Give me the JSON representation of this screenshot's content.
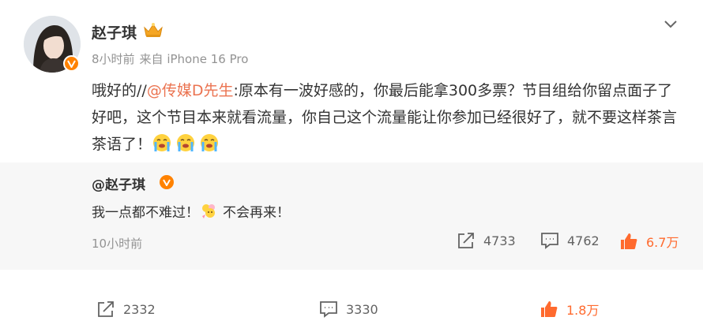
{
  "post": {
    "author": "赵子琪",
    "time": "8小时前",
    "source": "来自 iPhone 16 Pro",
    "text_prefix": "哦好的//",
    "mention": "@传媒D先生",
    "text_body": ":原本有一波好感的，你最后能拿300多票？节目组给你留点面子了好吧，这个节目本来就看流量，你自己这个流量能让你参加已经很好了，就不要这样茶言茶语了！",
    "emoji_count_label": "3"
  },
  "repost": {
    "author": "@赵子琪",
    "text_before": "我一点都不难过！",
    "text_after": "不会再来！",
    "time": "10小时前",
    "repost_count": "4733",
    "comment_count": "4762",
    "like_count": "6.7万"
  },
  "actions": {
    "repost_count": "2332",
    "comment_count": "3330",
    "like_count": "1.8万"
  },
  "colors": {
    "accent": "#ff8200",
    "mention": "#eb7350",
    "liked": "#ff6a2e",
    "muted": "#939393"
  },
  "icons": [
    "avatar-photo",
    "verified-badge-icon",
    "crown-icon",
    "chevron-down-icon",
    "crying-emoji-icon",
    "flower-emoji-icon",
    "repost-icon",
    "comment-icon",
    "like-icon"
  ]
}
